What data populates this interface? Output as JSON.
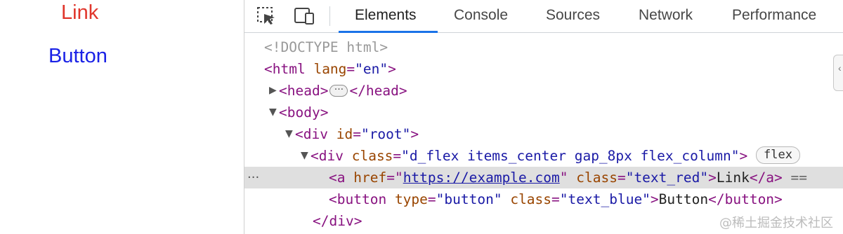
{
  "preview": {
    "link_text": "Link",
    "button_text": "Button"
  },
  "devtools": {
    "tabs": [
      {
        "label": "Elements",
        "active": true
      },
      {
        "label": "Console",
        "active": false
      },
      {
        "label": "Sources",
        "active": false
      },
      {
        "label": "Network",
        "active": false
      },
      {
        "label": "Performance",
        "active": false
      }
    ],
    "tools": [
      "select-element-icon",
      "device-toolbar-icon"
    ]
  },
  "dom_tree": {
    "doctype": "<!DOCTYPE html>",
    "html_tag_open": "<html",
    "html_attr": "lang",
    "html_val": "\"en\"",
    "html_close": ">",
    "head_open": "<head>",
    "head_close": "</head>",
    "body_open": "<body>",
    "div_root_open": "<div",
    "div_root_attr": "id",
    "div_root_val": "\"root\"",
    "div_root_close": ">",
    "div_flex_open": "<div",
    "div_flex_attr": "class",
    "div_flex_val": "\"d_flex items_center gap_8px flex_column\"",
    "div_flex_close": ">",
    "flex_badge": "flex",
    "a_open": "<a",
    "a_href_attr": "href",
    "a_href_val": "https://example.com",
    "a_class_attr": "class",
    "a_class_val": "\"text_red\"",
    "a_text": "Link",
    "a_close": "</a>",
    "a_marker": "==",
    "button_open": "<button",
    "button_type_attr": "type",
    "button_type_val": "\"button\"",
    "button_class_attr": "class",
    "button_class_val": "\"text_blue\"",
    "button_text": "Button",
    "button_close": "</button>",
    "div_end": "</div>"
  },
  "watermark": "@稀土掘金技术社区"
}
